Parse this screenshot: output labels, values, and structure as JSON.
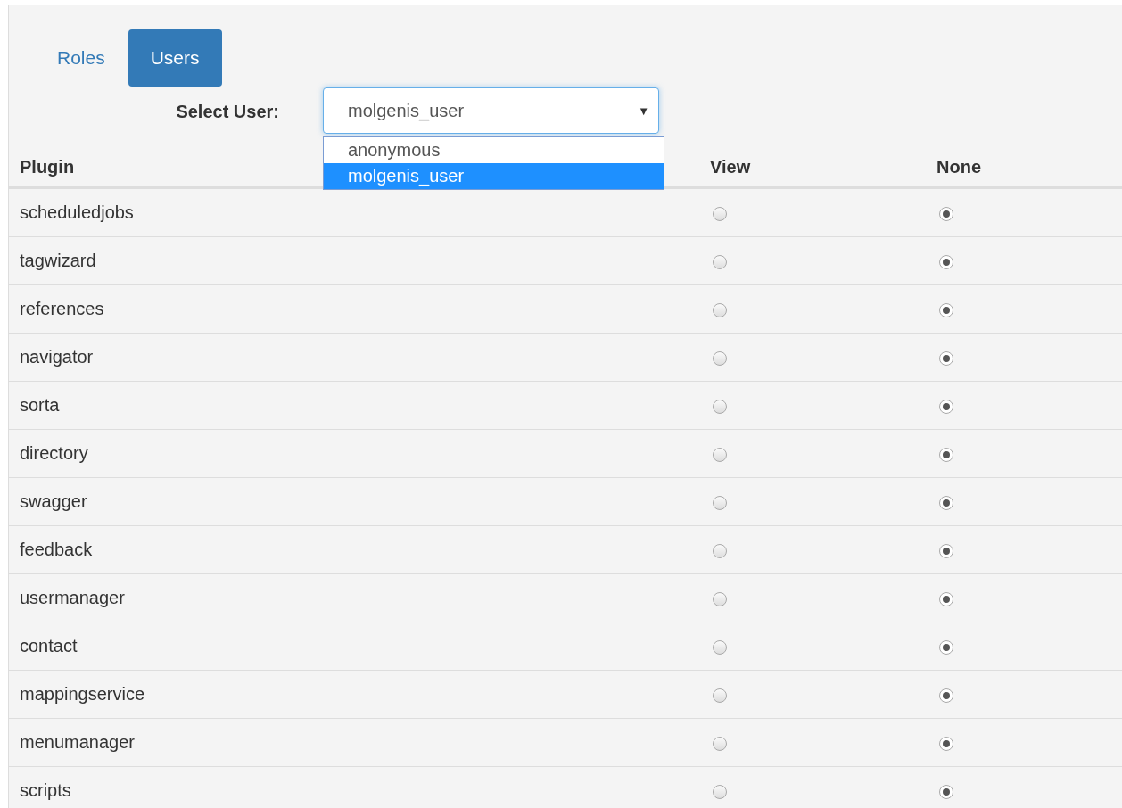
{
  "tabs": [
    {
      "label": "Roles",
      "selected": false
    },
    {
      "label": "Users",
      "selected": true
    }
  ],
  "select_user": {
    "label": "Select User:",
    "value": "molgenis_user",
    "arrow": "▼",
    "options": [
      {
        "label": "anonymous",
        "selected": false
      },
      {
        "label": "molgenis_user",
        "selected": true
      }
    ]
  },
  "table": {
    "columns": [
      "Plugin",
      "View",
      "None"
    ],
    "rows": [
      {
        "plugin": "scheduledjobs",
        "view": false,
        "none": true
      },
      {
        "plugin": "tagwizard",
        "view": false,
        "none": true
      },
      {
        "plugin": "references",
        "view": false,
        "none": true
      },
      {
        "plugin": "navigator",
        "view": false,
        "none": true
      },
      {
        "plugin": "sorta",
        "view": false,
        "none": true
      },
      {
        "plugin": "directory",
        "view": false,
        "none": true
      },
      {
        "plugin": "swagger",
        "view": false,
        "none": true
      },
      {
        "plugin": "feedback",
        "view": false,
        "none": true
      },
      {
        "plugin": "usermanager",
        "view": false,
        "none": true
      },
      {
        "plugin": "contact",
        "view": false,
        "none": true
      },
      {
        "plugin": "mappingservice",
        "view": false,
        "none": true
      },
      {
        "plugin": "menumanager",
        "view": false,
        "none": true
      },
      {
        "plugin": "scripts",
        "view": false,
        "none": true
      }
    ]
  }
}
